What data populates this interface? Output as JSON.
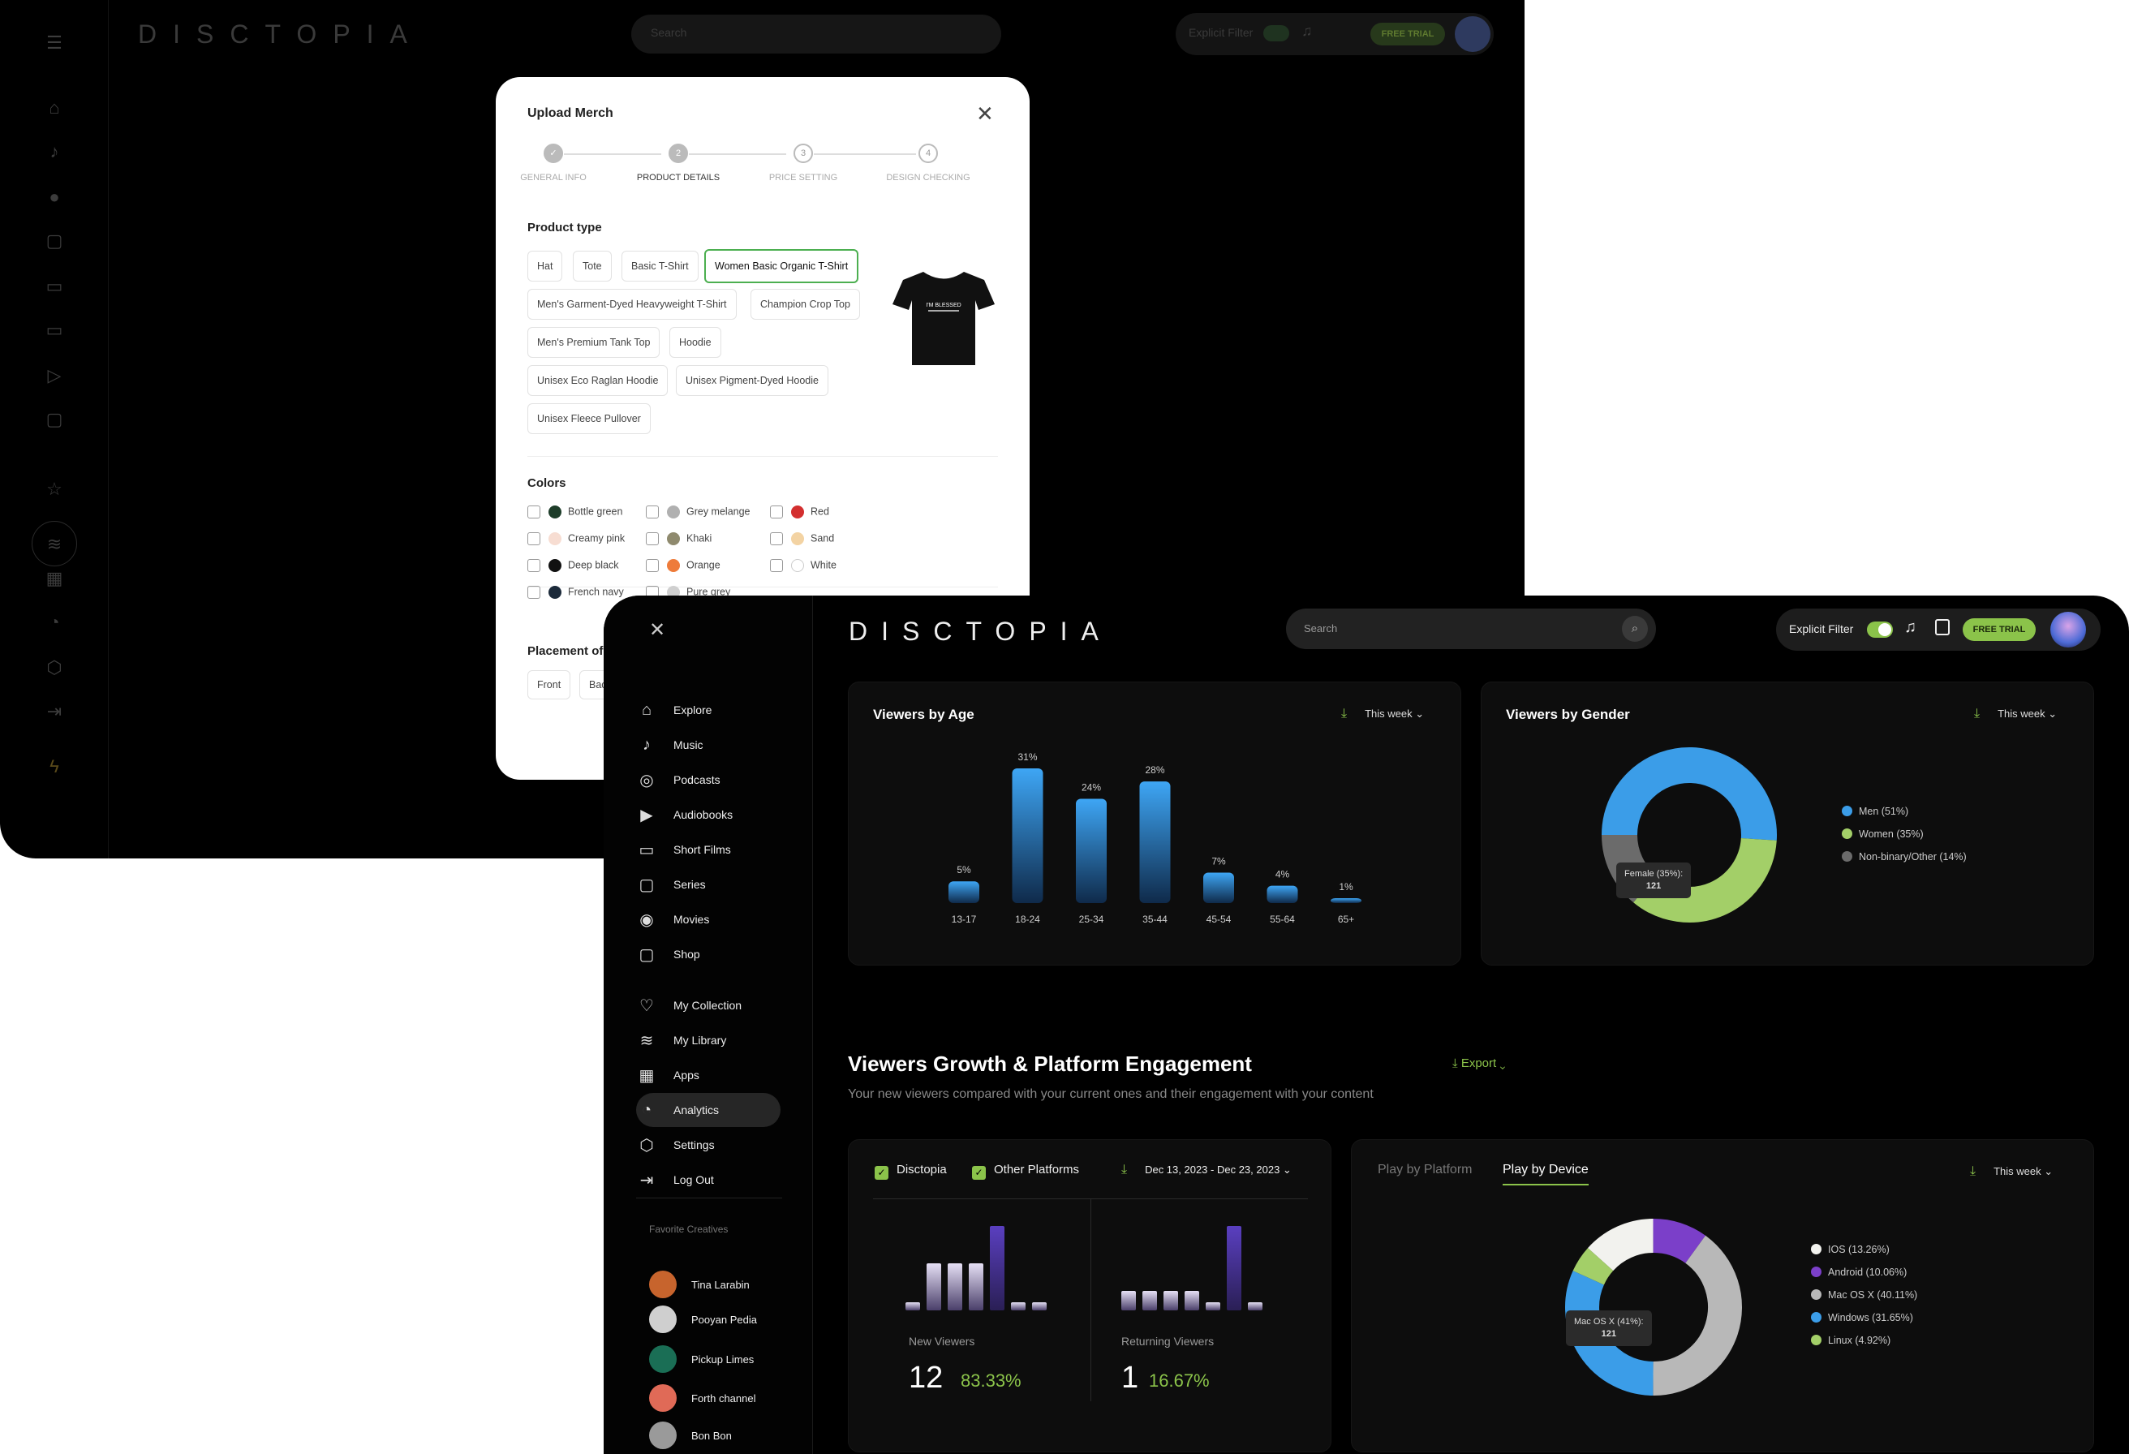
{
  "back": {
    "logo": "DISCTOPIA",
    "search_placeholder": "Search",
    "explicit_label": "Explicit Filter",
    "free_trial": "FREE TRIAL"
  },
  "modal": {
    "title": "Upload Merch",
    "steps": [
      {
        "num": "✓",
        "label": "GENERAL INFO"
      },
      {
        "num": "2",
        "label": "PRODUCT DETAILS"
      },
      {
        "num": "3",
        "label": "PRICE SETTING"
      },
      {
        "num": "4",
        "label": "DESIGN CHECKING"
      }
    ],
    "product_type_title": "Product type",
    "product_types": [
      "Hat",
      "Tote",
      "Basic T-Shirt",
      "Women Basic Organic T-Shirt",
      "Men's Garment-Dyed Heavyweight T-Shirt",
      "Champion Crop Top",
      "Men's Premium Tank Top",
      "Hoodie",
      "Unisex Eco Raglan Hoodie",
      "Unisex Pigment-Dyed Hoodie",
      "Unisex Fleece Pullover"
    ],
    "selected_type": "Women Basic Organic T-Shirt",
    "shirt_text": "I'M BLESSED",
    "colors_title": "Colors",
    "colors": [
      {
        "name": "Bottle green",
        "hex": "#1e3d2a"
      },
      {
        "name": "Grey melange",
        "hex": "#b0b0b0"
      },
      {
        "name": "Red",
        "hex": "#d32f2f"
      },
      {
        "name": "Creamy pink",
        "hex": "#f7ddd2"
      },
      {
        "name": "Khaki",
        "hex": "#8f8a6e"
      },
      {
        "name": "Sand",
        "hex": "#f3d3a3"
      },
      {
        "name": "Deep black",
        "hex": "#111111"
      },
      {
        "name": "Orange",
        "hex": "#ee7b3a"
      },
      {
        "name": "White",
        "hex": "#ffffff"
      },
      {
        "name": "French navy",
        "hex": "#1c2a3a"
      },
      {
        "name": "Pure grey",
        "hex": "#cfcfcf"
      }
    ],
    "placement_title": "Placement of",
    "placements": [
      "Front",
      "Back"
    ]
  },
  "front": {
    "logo": "DISCTOPIA",
    "search_placeholder": "Search",
    "explicit_label": "Explicit Filter",
    "free_trial": "FREE TRIAL"
  },
  "sidebar": {
    "items": [
      {
        "label": "Explore",
        "icon": "home-icon"
      },
      {
        "label": "Music",
        "icon": "music-icon"
      },
      {
        "label": "Podcasts",
        "icon": "mic-icon"
      },
      {
        "label": "Audiobooks",
        "icon": "audiobook-icon"
      },
      {
        "label": "Short Films",
        "icon": "video-icon"
      },
      {
        "label": "Series",
        "icon": "tv-icon"
      },
      {
        "label": "Movies",
        "icon": "play-icon"
      },
      {
        "label": "Shop",
        "icon": "bag-icon"
      }
    ],
    "items2": [
      {
        "label": "My Collection",
        "icon": "heart-icon"
      },
      {
        "label": "My Library",
        "icon": "layers-icon"
      },
      {
        "label": "Apps",
        "icon": "grid-icon"
      },
      {
        "label": "Analytics",
        "icon": "analytics-icon"
      },
      {
        "label": "Settings",
        "icon": "settings-icon"
      },
      {
        "label": "Log Out",
        "icon": "logout-icon"
      }
    ],
    "fav_title": "Favorite Creatives",
    "favorites": [
      {
        "name": "Tina Larabin",
        "color": "#c7642d"
      },
      {
        "name": "Pooyan Pedia",
        "color": "#cfcfcf"
      },
      {
        "name": "Pickup Limes",
        "color": "#1a6e55"
      },
      {
        "name": "Forth channel",
        "color": "#e06a57"
      },
      {
        "name": "Bon Bon",
        "color": "#9a9a9a"
      }
    ]
  },
  "age_panel": {
    "title": "Viewers by Age",
    "period": "This week",
    "chart_data": {
      "type": "bar",
      "categories": [
        "13-17",
        "18-24",
        "25-34",
        "35-44",
        "45-54",
        "55-64",
        "65+"
      ],
      "values": [
        5,
        31,
        24,
        28,
        7,
        4,
        1
      ],
      "value_labels": [
        "5%",
        "31%",
        "24%",
        "28%",
        "7%",
        "4%",
        "1%"
      ]
    }
  },
  "gender_panel": {
    "title": "Viewers by Gender",
    "period": "This week",
    "chart_data": {
      "type": "pie",
      "categories": [
        "Men (51%)",
        "Women (35%)",
        "Non-binary/Other (14%)"
      ],
      "values": [
        51,
        35,
        14
      ],
      "colors": [
        "#3b9de8",
        "#a3cf68",
        "#6b6b6b"
      ]
    },
    "tooltip_label": "Female (35%):",
    "tooltip_value": "121"
  },
  "growth": {
    "title": "Viewers Growth & Platform Engagement",
    "export": "Export",
    "subtitle": "Your new viewers compared with your current ones and their engagement with your content"
  },
  "viewers_panel": {
    "check1": "Disctopia",
    "check2": "Other Platforms",
    "date_range": "Dec 13, 2023 - Dec 23, 2023",
    "new_label": "New Viewers",
    "new_count": "12",
    "new_pct": "83.33%",
    "ret_label": "Returning Viewers",
    "ret_count": "1",
    "ret_pct": "16.67%"
  },
  "device_panel": {
    "tab1": "Play by Platform",
    "tab2": "Play by Device",
    "period": "This week",
    "chart_data": {
      "type": "pie",
      "categories": [
        "IOS (13.26%)",
        "Android (10.06%)",
        "Mac OS X  (40.11%)",
        "Windows (31.65%)",
        "Linux (4.92%)"
      ],
      "values": [
        13.26,
        10.06,
        40.11,
        31.65,
        4.92
      ],
      "colors": [
        "#f2f2ee",
        "#7b3fc9",
        "#b8b8b8",
        "#3b9de8",
        "#a3cf68"
      ]
    },
    "tooltip_label": "Mac OS X (41%):",
    "tooltip_value": "121"
  }
}
